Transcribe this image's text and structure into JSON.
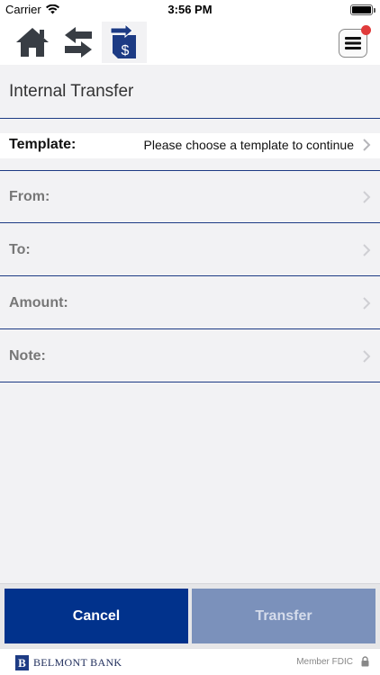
{
  "status_bar": {
    "carrier": "Carrier",
    "time": "3:56 PM",
    "icons": [
      "wifi-icon",
      "battery-icon"
    ]
  },
  "toolbar": {
    "icons": [
      "home-icon",
      "swap-arrows-icon",
      "transfer-dollar-icon",
      "hamburger-menu-icon"
    ],
    "notification_color": "#e03b3b"
  },
  "page": {
    "title": "Internal Transfer"
  },
  "form": {
    "rows": [
      {
        "label": "Template:",
        "value": "Please choose a template to continue"
      },
      {
        "label": "From:",
        "value": ""
      },
      {
        "label": "To:",
        "value": ""
      },
      {
        "label": "Amount:",
        "value": ""
      },
      {
        "label": "Note:",
        "value": ""
      }
    ]
  },
  "actions": {
    "cancel_label": "Cancel",
    "transfer_label": "Transfer"
  },
  "brand": {
    "logo_letter": "B",
    "name": "BELMONT BANK",
    "fdic": "Member FDIC"
  },
  "colors": {
    "primary": "#01328c",
    "disabled": "#7b91bb",
    "rule": "#1d3b84"
  }
}
